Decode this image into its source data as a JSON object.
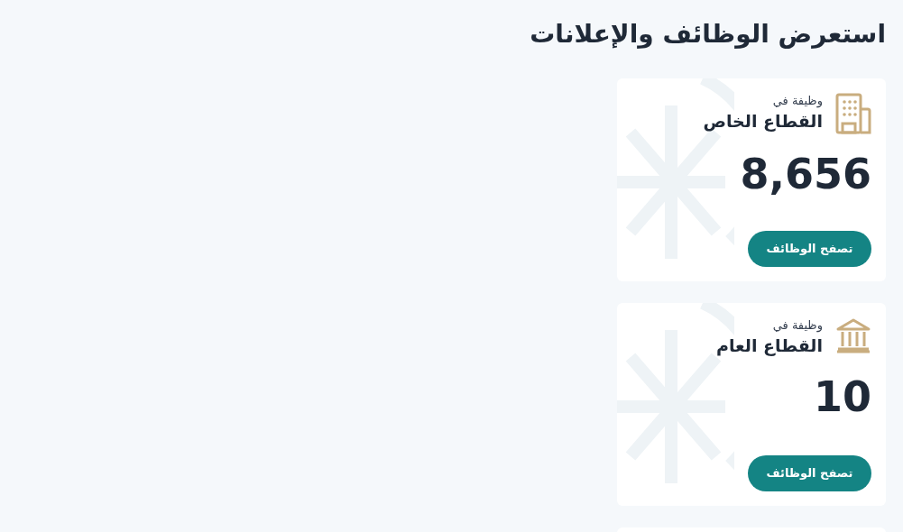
{
  "heading": "استعرض الوظائف والإعلانات",
  "cards": [
    {
      "kind": "building",
      "caption": "وظيفة في",
      "sector": "القطاع الخاص",
      "count": "8,656",
      "button": "تصفح الوظائف"
    },
    {
      "kind": "government",
      "caption": "وظيفة في",
      "sector": "القطاع العام",
      "count": "10",
      "button": "تصفح الوظائف"
    }
  ]
}
